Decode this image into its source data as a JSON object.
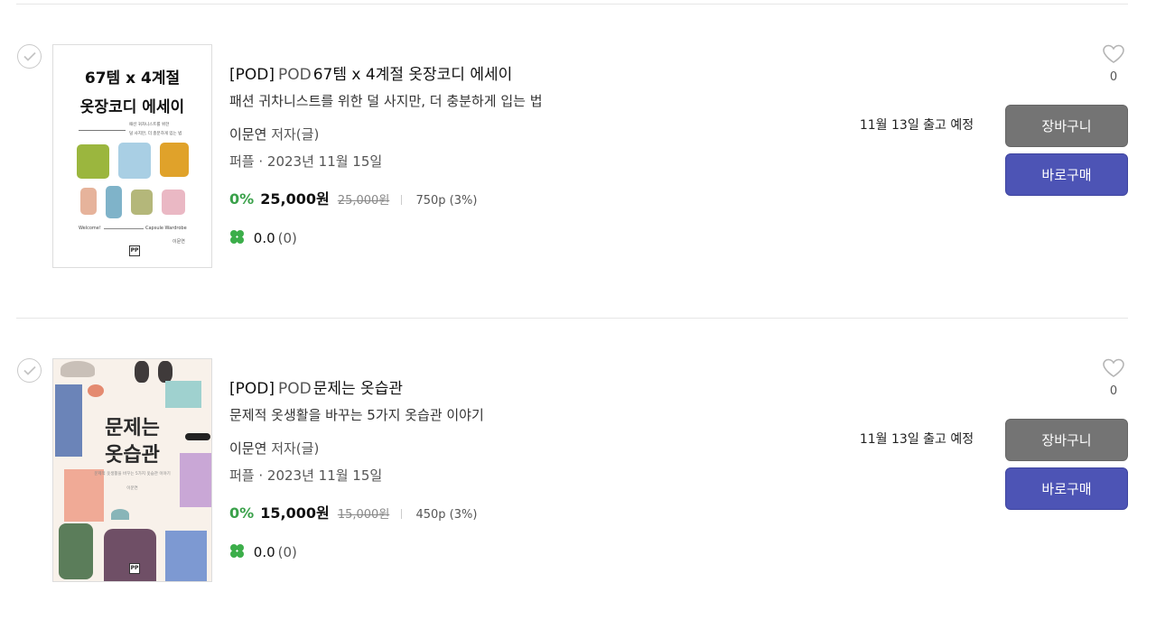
{
  "items": [
    {
      "tag": "[POD]",
      "pod_label": "POD",
      "title": "67템 x 4계절 옷장코디 에세이",
      "subtitle": "패션 귀차니스트를 위한 덜 사지만, 더 충분하게 입는 법",
      "author": "이문연",
      "author_role": "저자(글)",
      "publisher_date": "퍼플 · 2023년 11월 15일",
      "discount": "0%",
      "price": "25,000원",
      "original_price": "25,000원",
      "points": "750p (3%)",
      "rating": "0.0",
      "review_count": "(0)",
      "shipping": "11월 13일 출고 예정",
      "likes": "0",
      "cart_label": "장바구니",
      "buy_label": "바로구매",
      "cover": {
        "line1": "67템 x 4계절",
        "line2": "옷장코디 에세이",
        "sub1": "패션 귀차니스트를 위한",
        "sub2": "덜 사지만, 더 충분하게 입는 법",
        "foot_left": "Welcome!",
        "foot_right": "Capsule Wardrobe",
        "author": "이문연",
        "logo": "PP"
      }
    },
    {
      "tag": "[POD]",
      "pod_label": "POD",
      "title": "문제는 옷습관",
      "subtitle": "문제적 옷생활을 바꾸는 5가지 옷습관 이야기",
      "author": "이문연",
      "author_role": "저자(글)",
      "publisher_date": "퍼플 · 2023년 11월 15일",
      "discount": "0%",
      "price": "15,000원",
      "original_price": "15,000원",
      "points": "450p (3%)",
      "rating": "0.0",
      "review_count": "(0)",
      "shipping": "11월 13일 출고 예정",
      "likes": "0",
      "cart_label": "장바구니",
      "buy_label": "바로구매",
      "cover": {
        "line1": "문제는",
        "line2": "옷습관",
        "sub": "문제적 옷생활을 바꾸는 5가지 옷습관 이야기",
        "author": "이문연",
        "logo": "PP"
      }
    }
  ],
  "colors": {
    "discount": "#3aa14a",
    "cart_button": "#747474",
    "buy_button": "#4d54b5",
    "clover": "#3cae4a"
  },
  "icons": {
    "select": "check-circle-icon",
    "like": "heart-outline-icon",
    "rating": "clover-icon"
  }
}
